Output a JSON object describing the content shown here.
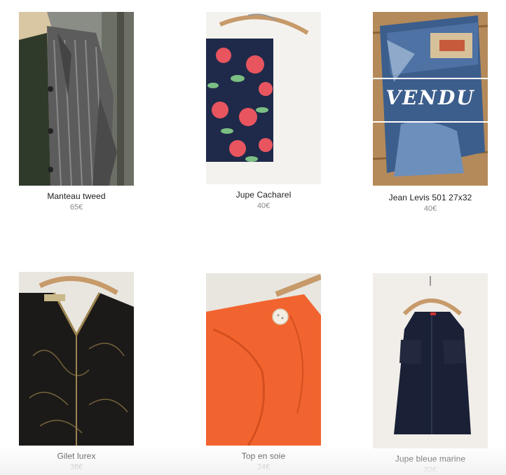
{
  "products": [
    {
      "title": "Manteau tweed",
      "price": "65€",
      "sold": false
    },
    {
      "title": "Jupe Cacharel",
      "price": "40€",
      "sold": false
    },
    {
      "title": "Jean Levis 501 27x32",
      "price": "40€",
      "sold": true,
      "sold_label": "VENDU"
    },
    {
      "title": "Gilet lurex",
      "price": "38€",
      "sold": false
    },
    {
      "title": "Top en soie",
      "price": "24€",
      "sold": false
    },
    {
      "title": "Jupe bleue marine",
      "price": "32€",
      "sold": false
    }
  ],
  "colors": {
    "title": "#1d1d1d",
    "price": "#8a8a8a",
    "coat": "#5a5a5a",
    "skirt_floral_bg": "#1f2a4a",
    "rose": "#e8555f",
    "denim": "#3c5e8c",
    "cardigan": "#1c1a18",
    "silk_top": "#f2642f",
    "navy_skirt": "#1a2036"
  }
}
